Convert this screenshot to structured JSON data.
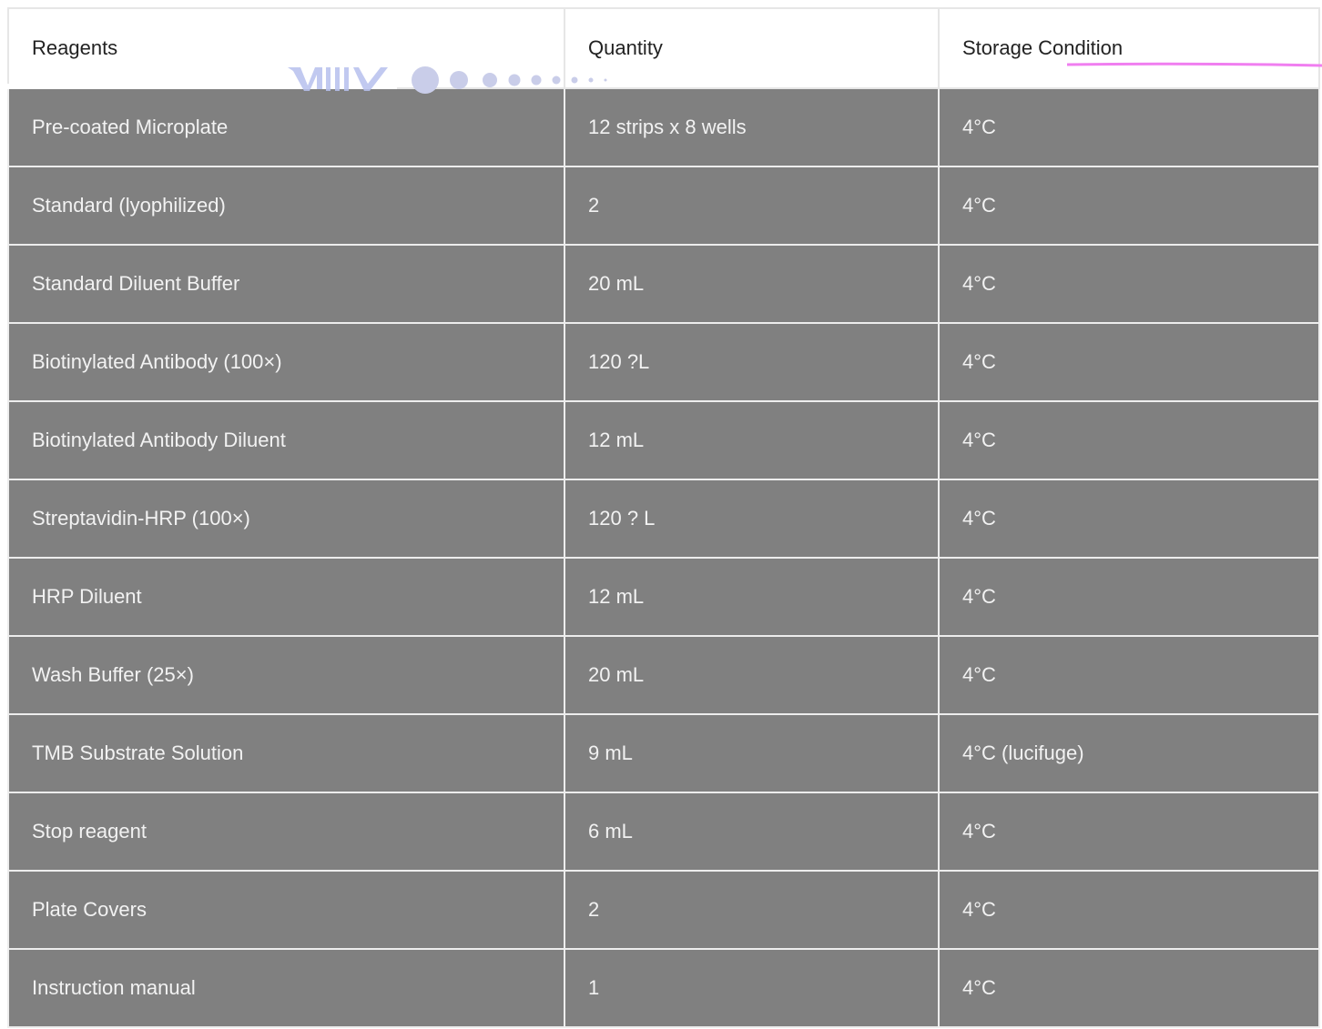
{
  "table": {
    "headers": [
      "Reagents",
      "Quantity",
      "Storage Condition"
    ],
    "rows": [
      [
        "Pre-coated Microplate",
        "12 strips x 8 wells",
        "4°C"
      ],
      [
        "Standard (lyophilized)",
        "2",
        "4°C"
      ],
      [
        "Standard Diluent Buffer",
        "20 mL",
        "4°C"
      ],
      [
        "Biotinylated Antibody (100×)",
        "120 ?L",
        "4°C"
      ],
      [
        "Biotinylated Antibody Diluent",
        "12 mL",
        "4°C"
      ],
      [
        "Streptavidin-HRP (100×)",
        "120 ? L",
        "4°C"
      ],
      [
        "HRP Diluent",
        "12 mL",
        "4°C"
      ],
      [
        "Wash Buffer (25×)",
        "20 mL",
        "4°C"
      ],
      [
        "TMB Substrate Solution",
        "9 mL",
        "4°C (lucifuge)"
      ],
      [
        "Stop reagent",
        "6 mL",
        "4°C"
      ],
      [
        "Plate Covers",
        "2",
        "4°C"
      ],
      [
        "Instruction manual",
        "1",
        "4°C"
      ]
    ]
  },
  "colors": {
    "header_bg": "#ffffff",
    "row_bg": "#808080",
    "row_text": "#f2f2f2",
    "grid": "#ededed",
    "accent_pink": "#f07ef0",
    "watermark_blue": "#9aa7e8"
  },
  "decorations": {
    "watermark": "decorative-watermark-logo",
    "underline": "pink-underline"
  }
}
